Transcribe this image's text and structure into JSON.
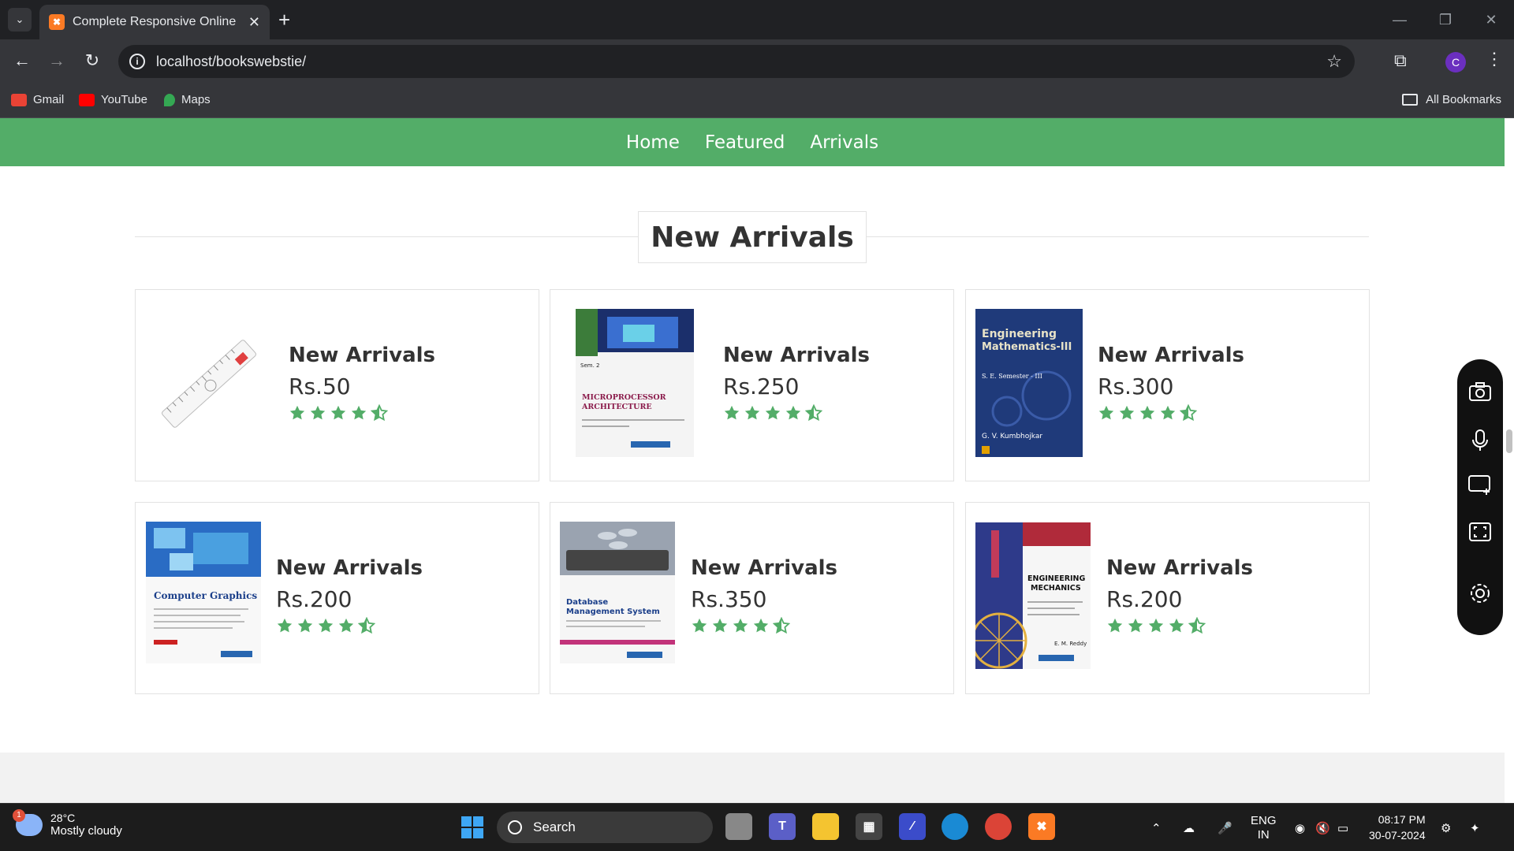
{
  "browser": {
    "tab_title": "Complete Responsive Online Bo",
    "url": "localhost/bookswebstie/",
    "profile_initial": "C",
    "bookmarks": [
      {
        "label": "Gmail",
        "color": "#ea4335"
      },
      {
        "label": "YouTube",
        "color": "#ff0000"
      },
      {
        "label": "Maps",
        "color": "#34a853"
      }
    ],
    "all_bookmarks": "All Bookmarks"
  },
  "navbar": {
    "links": [
      "Home",
      "Featured",
      "Arrivals"
    ],
    "bg_color": "#53ad68"
  },
  "section": {
    "title": "New Arrivals"
  },
  "products": [
    {
      "name": "New Arrivals",
      "price": "Rs.50",
      "rating": 4.5,
      "image": "ruler"
    },
    {
      "name": "New Arrivals",
      "price": "Rs.250",
      "rating": 4.5,
      "image": "book-microprocessor-architecture"
    },
    {
      "name": "New Arrivals",
      "price": "Rs.300",
      "rating": 4.5,
      "image": "book-engineering-mathematics-iii"
    },
    {
      "name": "New Arrivals",
      "price": "Rs.200",
      "rating": 4.5,
      "image": "book-computer-graphics"
    },
    {
      "name": "New Arrivals",
      "price": "Rs.350",
      "rating": 4.5,
      "image": "book-database-management-system"
    },
    {
      "name": "New Arrivals",
      "price": "Rs.200",
      "rating": 4.5,
      "image": "book-engineering-mechanics"
    }
  ],
  "book_covers": {
    "micro_title": "MICROPROCESSOR ARCHITECTURE",
    "micro_sem": "Sem. 2",
    "math_title": "Engineering Mathematics-III",
    "math_sem": "S. E. Semester - III",
    "math_author": "G. V. Kumbhojkar",
    "cg_title": "Computer Graphics",
    "dbms_title": "Database Management System",
    "mech_title": "ENGINEERING MECHANICS",
    "mech_author": "E. M. Reddy"
  },
  "taskbar": {
    "temperature": "28°C",
    "weather": "Mostly cloudy",
    "weather_badge": "1",
    "search_placeholder": "Search",
    "language": "ENG",
    "region": "IN",
    "time": "08:17 PM",
    "date": "30-07-2024"
  },
  "colors": {
    "star": "#53ad68",
    "text": "#333333",
    "border": "#e2e2e2"
  }
}
